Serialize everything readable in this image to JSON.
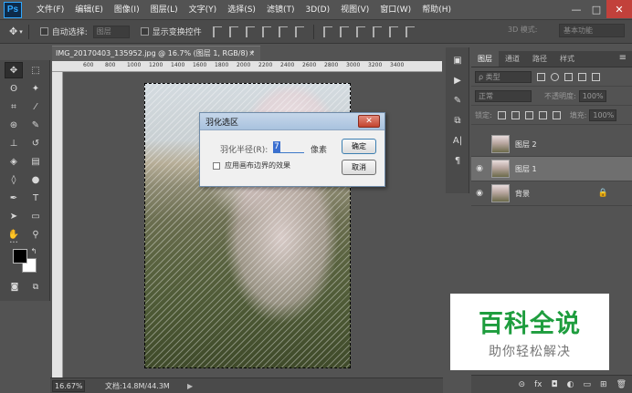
{
  "app": {
    "logo": "Ps",
    "menus": [
      "文件(F)",
      "编辑(E)",
      "图像(I)",
      "图层(L)",
      "文字(Y)",
      "选择(S)",
      "滤镜(T)",
      "3D(D)",
      "视图(V)",
      "窗口(W)",
      "帮助(H)"
    ],
    "window_controls": {
      "minimize": "—",
      "maximize": "□",
      "close": "✕"
    }
  },
  "options": {
    "move_glyph": "✥",
    "auto_select_label": "自动选择:",
    "auto_select_value": "图层",
    "show_transform_label": "显示变换控件",
    "mode_3d_label": "3D 模式:",
    "workspace": "基本功能"
  },
  "document": {
    "tab_title": "IMG_20170403_135952.jpg @ 16.7% (图层 1, RGB/8) *",
    "tab_close": "×",
    "ruler_ticks": [
      "600",
      "800",
      "1000",
      "1200",
      "1400",
      "1600",
      "1800",
      "2000",
      "2200",
      "2400",
      "2600",
      "2800",
      "3000",
      "3200",
      "3400"
    ],
    "zoom": "16.67%",
    "doc_info": "文档:14.8M/44.3M",
    "status_arrow": "▶"
  },
  "dialog": {
    "title": "羽化选区",
    "close_glyph": "✕",
    "radius_label": "羽化半径(R):",
    "radius_value": "7",
    "unit": "像素",
    "canvas_bounds_label": "应用画布边界的效果",
    "ok_label": "确定",
    "cancel_label": "取消"
  },
  "layers_panel": {
    "tabs": [
      "图层",
      "通道",
      "路径",
      "样式"
    ],
    "menu_glyph": "≡",
    "kind_filter": "ρ 类型",
    "blend_mode": "正常",
    "opacity_label": "不透明度:",
    "opacity_value": "100%",
    "lock_label": "锁定:",
    "fill_label": "填充:",
    "fill_value": "100%",
    "layers": [
      {
        "name": "图层 2",
        "visible": false,
        "selected": false
      },
      {
        "name": "图层 1",
        "visible": true,
        "selected": true
      },
      {
        "name": "背景",
        "visible": true,
        "selected": false,
        "locked": true
      }
    ],
    "eye_glyph": "◉",
    "lock_glyph": "🔒",
    "footer_icons": [
      "⊝",
      "fx",
      "◘",
      "◐",
      "▭",
      "⊞",
      "🗑"
    ]
  },
  "dock_icons": [
    "▣",
    "▶",
    "✎",
    "⧉",
    "A|",
    "¶"
  ],
  "watermark": {
    "title": "百科全说",
    "subtitle": "助你轻松解决"
  },
  "colors": {
    "foreground": "#000000",
    "background": "#ffffff",
    "accent": "#1e9d3e"
  }
}
